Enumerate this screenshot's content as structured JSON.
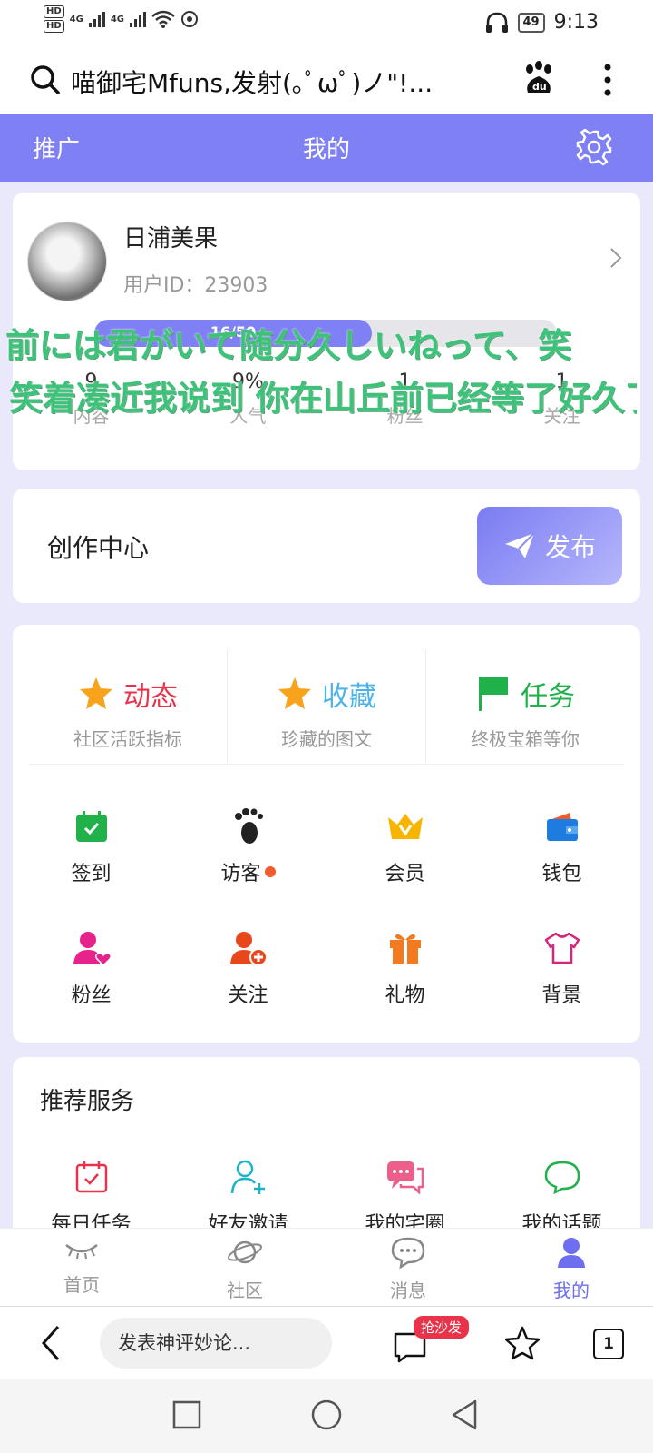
{
  "status": {
    "hd1": "HD",
    "hd2": "HD",
    "net1": "4G",
    "net2": "4G",
    "battery": "49",
    "time": "9:13"
  },
  "browser": {
    "title": "喵御宅Mfuns,发射(｡ﾟωﾟ)ノ\"!...",
    "comment_placeholder": "发表神评妙论...",
    "comment_badge": "抢沙发",
    "tab_count": "1"
  },
  "header": {
    "left": "推广",
    "title": "我的"
  },
  "profile": {
    "name": "日浦美果",
    "user_id": "用户ID：23903",
    "progress_text": "16/50",
    "progress_fraction": 0.6,
    "stats": [
      {
        "num": "9",
        "label": "内容"
      },
      {
        "num": "9%",
        "label": "人气"
      },
      {
        "num": "1",
        "label": "粉丝"
      },
      {
        "num": "1",
        "label": "关注"
      }
    ]
  },
  "danmaku": [
    "前には君がいて随分久しいねって、笑",
    "笑着凑近我说到 你在山丘前已经等了好久了"
  ],
  "create": {
    "label": "创作中心",
    "publish": "发布"
  },
  "top_features": [
    {
      "name": "动态",
      "sub": "社区活跃指标",
      "color": "#e8334a",
      "icon": "star-icon"
    },
    {
      "name": "收藏",
      "sub": "珍藏的图文",
      "color": "#4fb3e8",
      "icon": "star-icon"
    },
    {
      "name": "任务",
      "sub": "终极宝箱等你",
      "color": "#21b14a",
      "icon": "flag-icon"
    }
  ],
  "grid": [
    {
      "label": "签到",
      "icon": "calendar-check-icon",
      "color": "#21b14a"
    },
    {
      "label": "访客",
      "icon": "footprint-icon",
      "color": "#222222"
    },
    {
      "label": "会员",
      "icon": "crown-icon",
      "color": "#f7b500"
    },
    {
      "label": "钱包",
      "icon": "wallet-icon",
      "color": "#1e7be0"
    },
    {
      "label": "粉丝",
      "icon": "fan-user-icon",
      "color": "#e6228b"
    },
    {
      "label": "关注",
      "icon": "follow-user-icon",
      "color": "#e8471c"
    },
    {
      "label": "礼物",
      "icon": "gift-icon",
      "color": "#f47a20"
    },
    {
      "label": "背景",
      "icon": "shirt-icon",
      "color": "#d6257a"
    }
  ],
  "services": {
    "title": "推荐服务",
    "items": [
      {
        "label": "每日任务",
        "icon": "daily-task-icon",
        "color": "#e8334a"
      },
      {
        "label": "好友邀请",
        "icon": "invite-friend-icon",
        "color": "#1bb3c9"
      },
      {
        "label": "我的宅圈",
        "icon": "chat-bubbles-icon",
        "color": "#ec5f8a"
      },
      {
        "label": "我的话题",
        "icon": "topic-bubble-icon",
        "color": "#21b14a"
      }
    ]
  },
  "tabs": [
    {
      "label": "首页",
      "icon": "eye-lashes-icon",
      "active": false
    },
    {
      "label": "社区",
      "icon": "planet-icon",
      "active": false
    },
    {
      "label": "消息",
      "icon": "message-icon",
      "active": false
    },
    {
      "label": "我的",
      "icon": "user-icon",
      "active": true
    }
  ]
}
